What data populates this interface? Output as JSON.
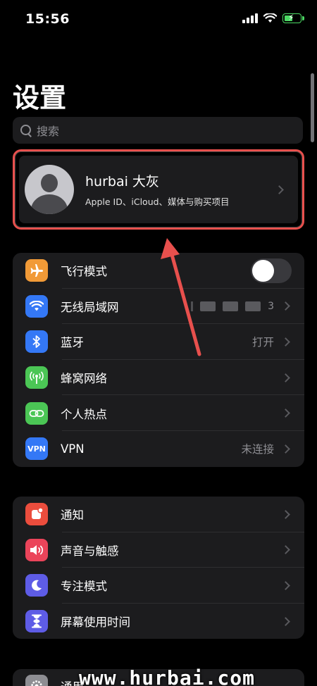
{
  "status_bar": {
    "time": "15:56",
    "icons": [
      "signal-icon",
      "wifi-icon",
      "battery-charging-icon"
    ],
    "battery_color": "#4cd964"
  },
  "title": "设置",
  "search": {
    "placeholder": "搜索"
  },
  "profile": {
    "name": "hurbai 大灰",
    "subtitle": "Apple ID、iCloud、媒体与购买项目",
    "highlight_color": "#e8504d"
  },
  "groups": [
    {
      "rows": [
        {
          "label": "飞行模式",
          "icon": "airplane-icon",
          "icon_bg": "#f19a37",
          "control": "toggle",
          "toggle_on": false
        },
        {
          "label": "无线局域网",
          "icon": "wifi-icon",
          "icon_bg": "#3478f6",
          "value_edge": "3"
        },
        {
          "label": "蓝牙",
          "icon": "bluetooth-icon",
          "icon_bg": "#3478f6",
          "value": "打开"
        },
        {
          "label": "蜂窝网络",
          "icon": "cellular-icon",
          "icon_bg": "#4bc655"
        },
        {
          "label": "个人热点",
          "icon": "hotspot-icon",
          "icon_bg": "#4bc655"
        },
        {
          "label": "VPN",
          "icon": "vpn-icon",
          "icon_text": "VPN",
          "icon_bg": "#3478f6",
          "value": "未连接"
        }
      ]
    },
    {
      "rows": [
        {
          "label": "通知",
          "icon": "notifications-icon",
          "icon_bg": "#eb4d3d"
        },
        {
          "label": "声音与触感",
          "icon": "sound-icon",
          "icon_bg": "#eb445a"
        },
        {
          "label": "专注模式",
          "icon": "focus-moon-icon",
          "icon_bg": "#5e5ce6"
        },
        {
          "label": "屏幕使用时间",
          "icon": "screen-time-icon",
          "icon_bg": "#5e5ce6"
        }
      ]
    },
    {
      "rows": [
        {
          "label": "通用",
          "icon": "general-gear-icon",
          "icon_bg": "#8e8e93"
        }
      ]
    }
  ],
  "annotation": {
    "arrow_color": "#e8504d"
  },
  "watermark": "www.hurbai.com"
}
